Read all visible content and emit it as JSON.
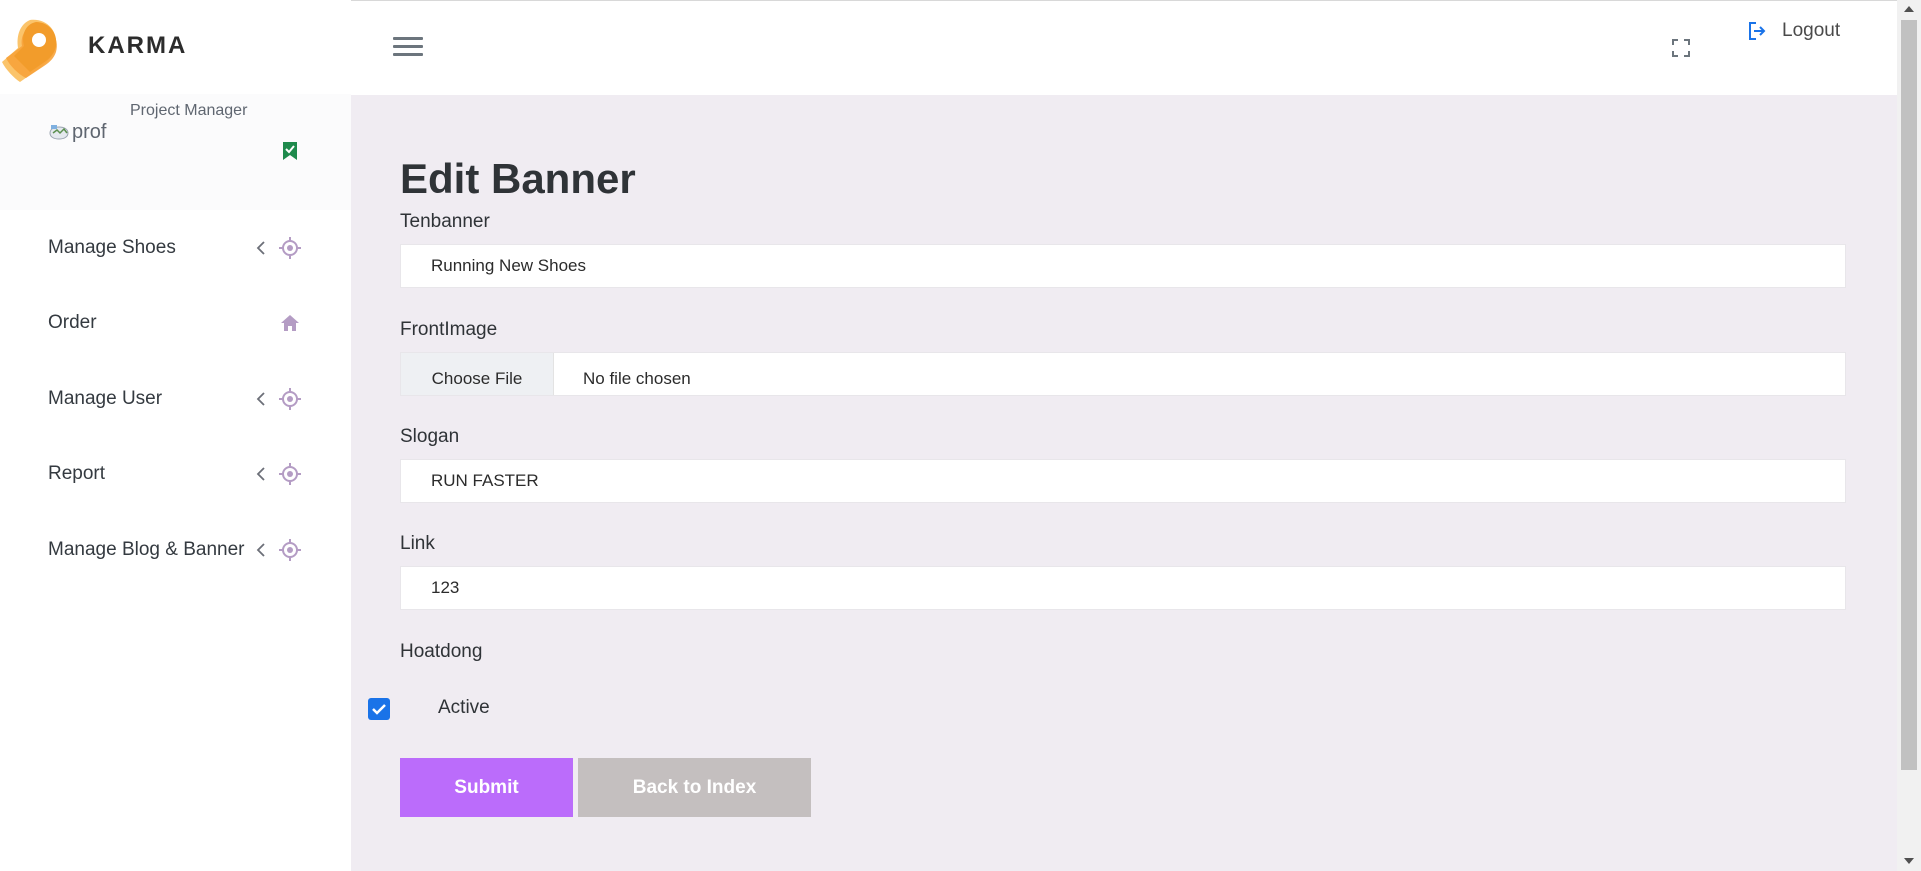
{
  "brand": {
    "name": "KARMA",
    "logo_icon": "map-pin-tag-logo"
  },
  "profile": {
    "role": "Project Manager",
    "image_alt": "prof",
    "badge_icon": "bookmark-check-icon"
  },
  "sidebar": {
    "items": [
      {
        "label": "Manage Shoes",
        "has_submenu": true,
        "icon": "target-icon"
      },
      {
        "label": "Order",
        "has_submenu": false,
        "icon": "home-icon"
      },
      {
        "label": "Manage User",
        "has_submenu": true,
        "icon": "target-icon"
      },
      {
        "label": "Report",
        "has_submenu": true,
        "icon": "target-icon"
      },
      {
        "label": "Manage Blog & Banner",
        "has_submenu": true,
        "icon": "target-icon"
      }
    ]
  },
  "header": {
    "menu_icon": "hamburger-icon",
    "fullscreen_icon": "fullscreen-icon",
    "logout_label": "Logout",
    "logout_icon": "logout-icon"
  },
  "form": {
    "title": "Edit Banner",
    "tenbanner": {
      "label": "Tenbanner",
      "value": "Running New Shoes"
    },
    "frontimage": {
      "label": "FrontImage",
      "button_label": "Choose File",
      "status": "No file chosen"
    },
    "slogan": {
      "label": "Slogan",
      "value": "RUN FASTER"
    },
    "link": {
      "label": "Link",
      "value": "123"
    },
    "hoatdong": {
      "label": "Hoatdong",
      "checkbox_label": "Active",
      "checked": true
    },
    "submit_label": "Submit",
    "back_label": "Back to Index"
  },
  "colors": {
    "accent_purple": "#bb6cfb",
    "back_button": "#c4bfbf",
    "main_bg": "#f0ecf2",
    "sidebar_icon": "#b49cc4",
    "checkbox_blue": "#1a73e8",
    "logo_orange": "#f7a33b"
  }
}
